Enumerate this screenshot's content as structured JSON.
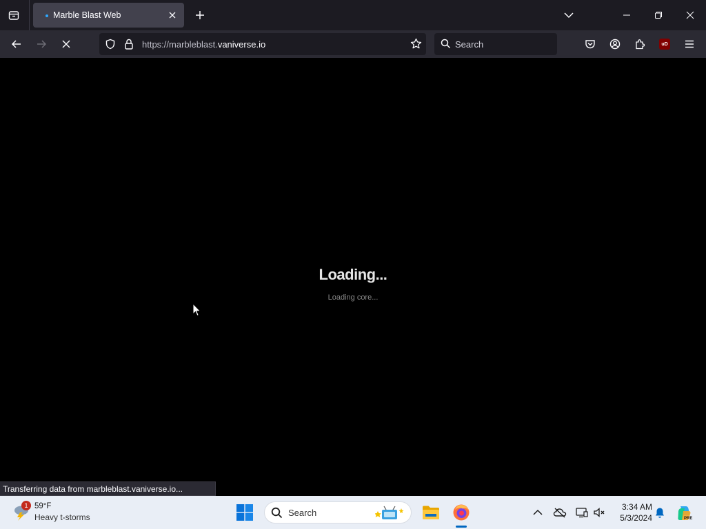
{
  "browser": {
    "tab": {
      "title": "Marble Blast Web",
      "close_label": "×"
    },
    "url": {
      "prefix": "https://marbleblast.",
      "domain": "vaniverse.io"
    },
    "search_placeholder": "Search",
    "ublock_label": "uD"
  },
  "page": {
    "loading_title": "Loading...",
    "loading_subtitle": "Loading core...",
    "status_text": "Transferring data from marbleblast.vaniverse.io..."
  },
  "taskbar": {
    "weather": {
      "badge": "1",
      "temp": "59°F",
      "condition": "Heavy t-storms"
    },
    "search_placeholder": "Search",
    "clock": {
      "time": "3:34 AM",
      "date": "5/3/2024"
    },
    "copilot_label": "PRE"
  },
  "colors": {
    "tabbar_bg": "#1c1b22",
    "navbar_bg": "#2b2a33",
    "active_tab_bg": "#42414d",
    "content_bg": "#000000",
    "taskbar_bg": "#e9eef6",
    "accent": "#0067c0"
  },
  "icons": [
    "list-all-tabs-icon",
    "tab-favicon-dot",
    "close-icon",
    "plus-icon",
    "chevron-down-icon",
    "minimize-icon",
    "restore-icon",
    "window-close-icon",
    "back-arrow-icon",
    "forward-arrow-icon",
    "stop-loading-icon",
    "shield-icon",
    "lock-icon",
    "star-icon",
    "search-icon",
    "pocket-icon",
    "account-icon",
    "extensions-icon",
    "ublock-icon",
    "menu-icon",
    "mouse-cursor-icon",
    "weather-storm-icon",
    "windows-start-icon",
    "file-explorer-icon",
    "firefox-icon",
    "chevron-up-icon",
    "onedrive-icon",
    "display-icon",
    "volume-muted-icon",
    "bell-icon",
    "copilot-icon"
  ]
}
